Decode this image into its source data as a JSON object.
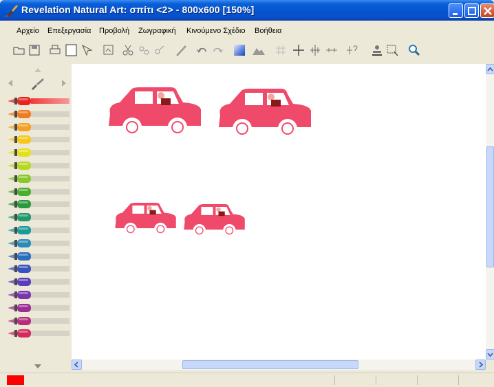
{
  "window": {
    "title": "Revelation Natural Art: σπίτι <2> - 800x600 [150%]"
  },
  "menu": [
    "Αρχείο",
    "Επεξεργασία",
    "Προβολή",
    "Ζωγραφική",
    "Κινούμενο Σχέδιο",
    "Βοήθεια"
  ],
  "toolbar_icons": [
    "open-icon",
    "save-icon",
    "print-icon",
    "new-page-icon",
    "select-tool-icon",
    "image-icon",
    "cut-icon",
    "copy-icon",
    "paste-icon",
    "pen-icon",
    "undo-icon",
    "redo-icon",
    "gradient-icon",
    "landscape-icon",
    "grid-icon",
    "cross-icon",
    "spread-icon",
    "line-icon",
    "help-cursor-icon",
    "stamp-icon",
    "crop-icon",
    "zoom-icon"
  ],
  "palette": {
    "crayon_colors": [
      "#e8241c",
      "#f07a20",
      "#f5a020",
      "#f5c81a",
      "#e6e01a",
      "#b8d820",
      "#88c828",
      "#4cae30",
      "#2c9a3c",
      "#209a6a",
      "#1c9a9a",
      "#2a8aba",
      "#2a6ec0",
      "#3a52c0",
      "#5a3ebc",
      "#7a36b0",
      "#9a2e96",
      "#b82a7a",
      "#d42a5e"
    ],
    "selected_index": 0
  },
  "canvas": {
    "car_color": "#f04a6a",
    "window_color": "#ffffff",
    "driver_skin": "#f2a8a0",
    "driver_body": "#8a1a1a"
  },
  "status": {
    "current_color": "#ff0000"
  }
}
